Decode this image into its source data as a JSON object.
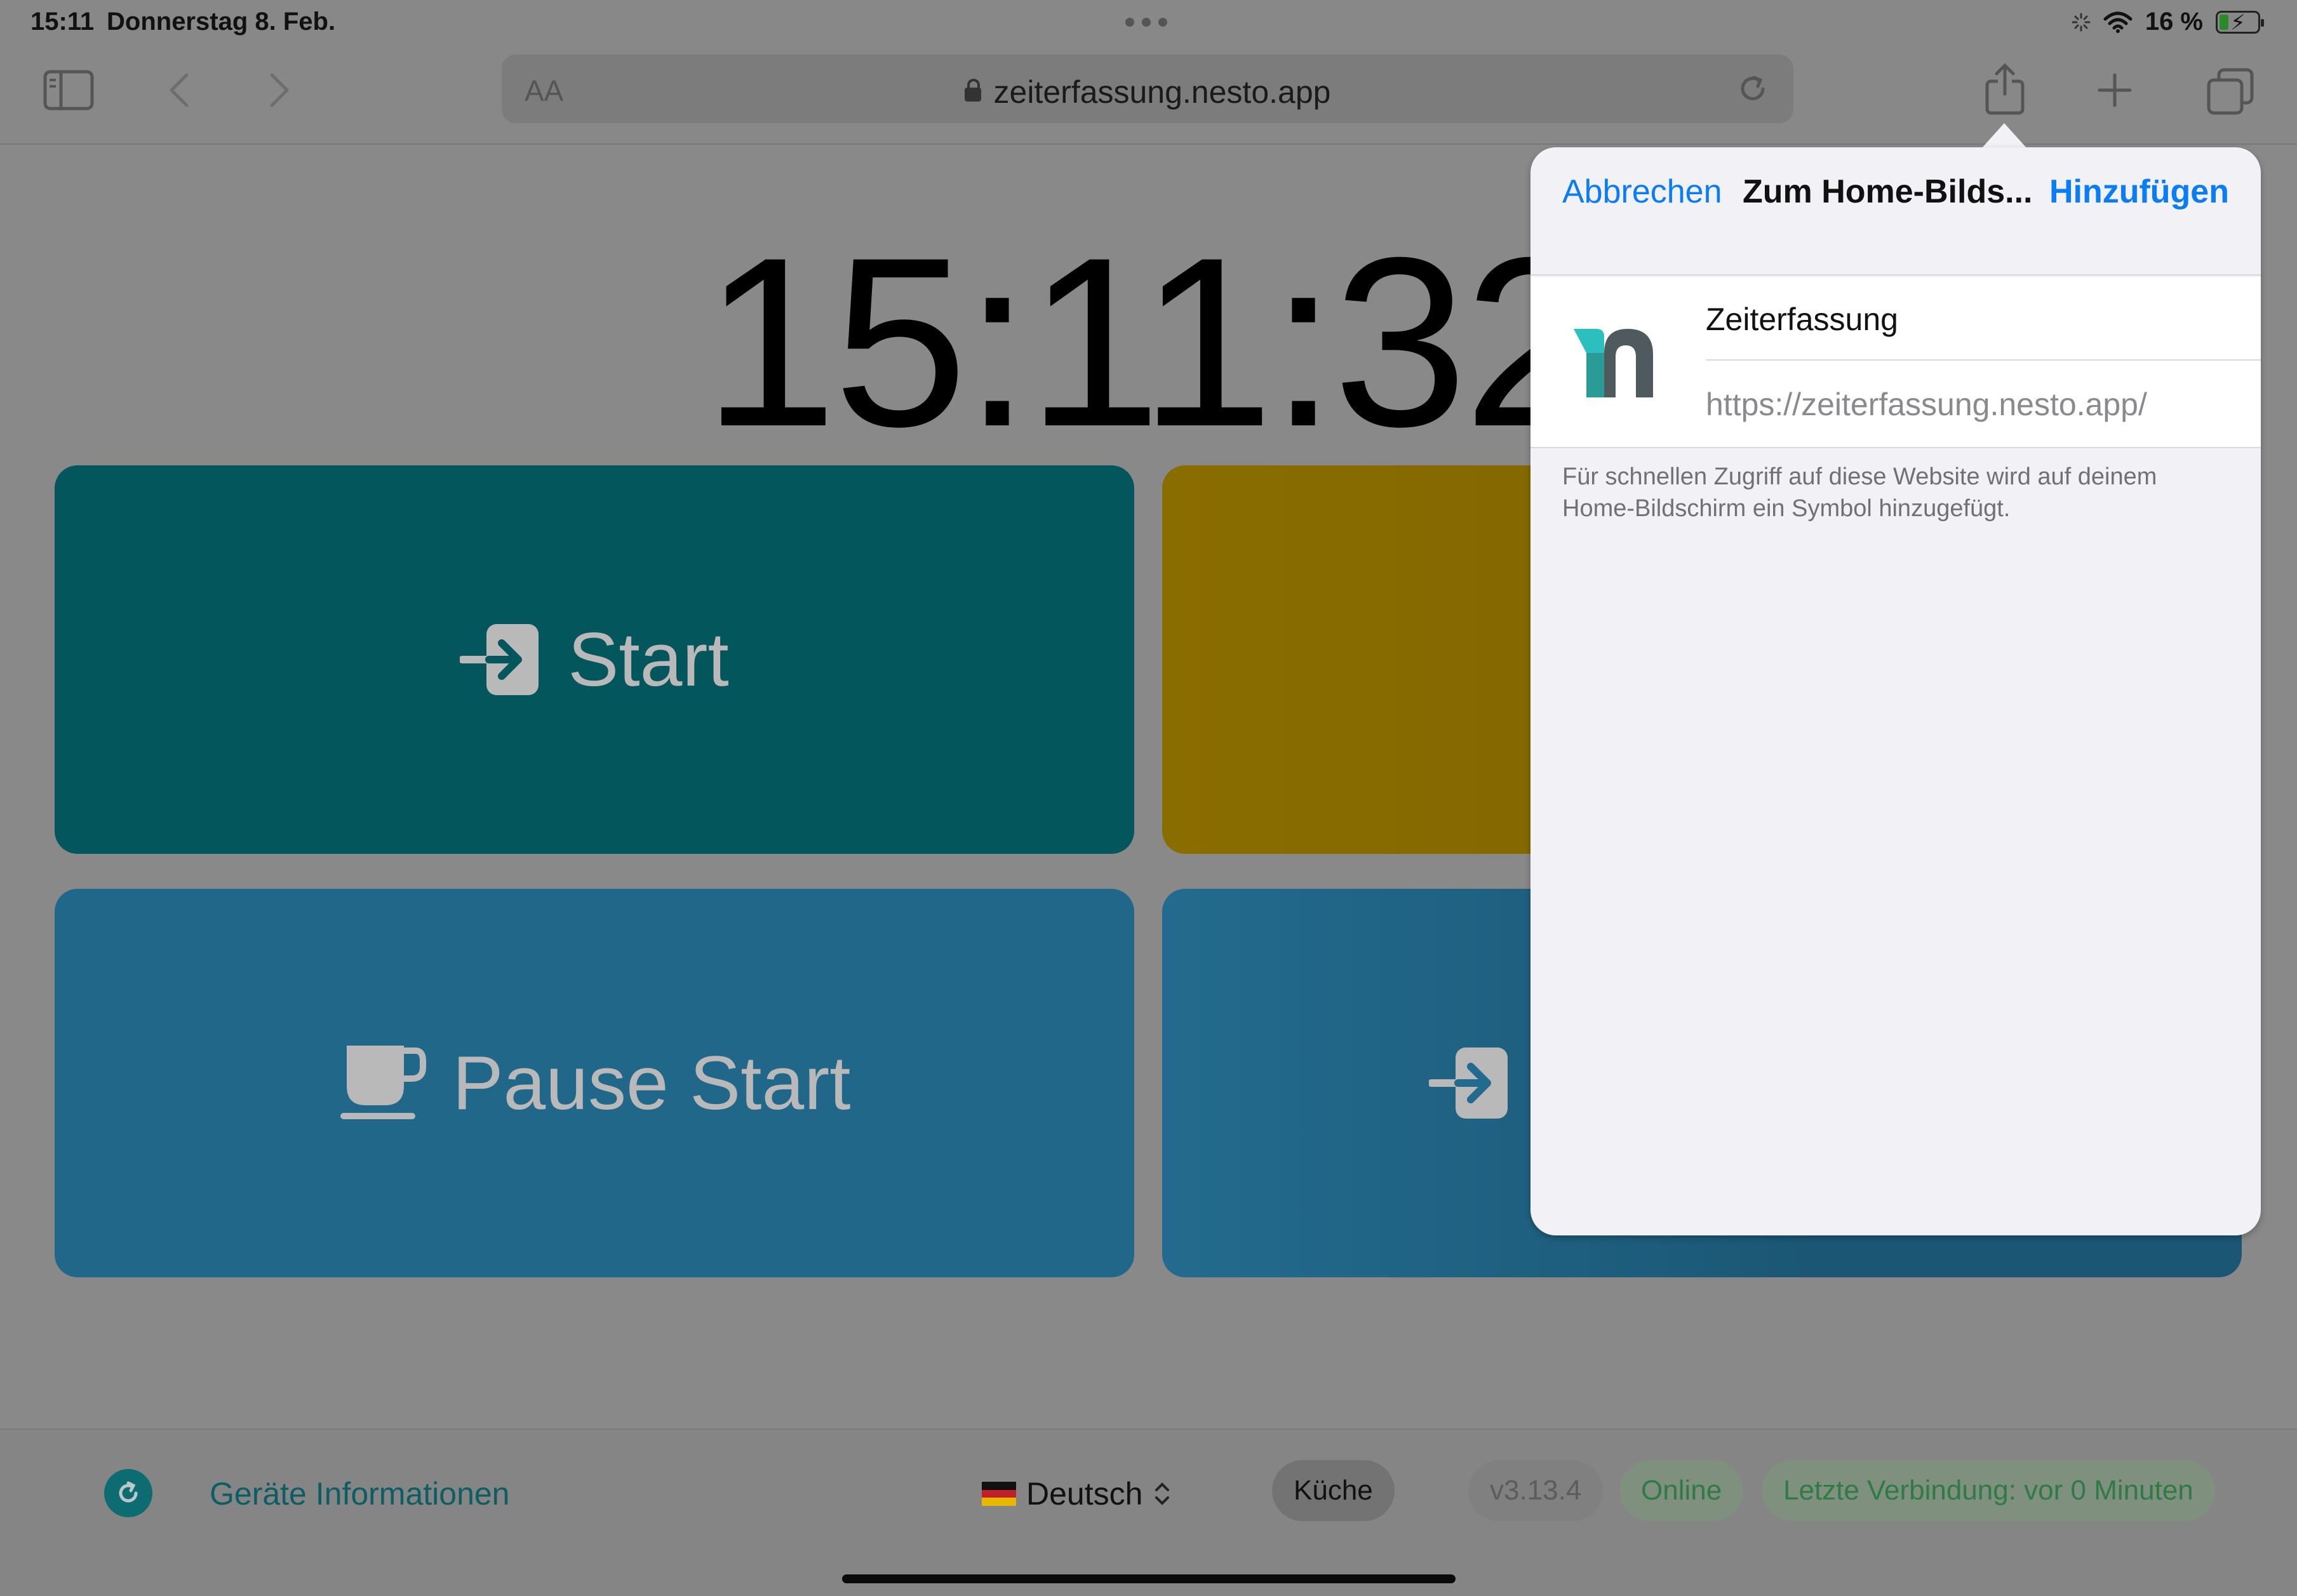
{
  "status_bar": {
    "time": "15:11",
    "date": "Donnerstag 8. Feb.",
    "battery": "16 %"
  },
  "browser": {
    "text_size_label": "AA",
    "url": "zeiterfassung.nesto.app"
  },
  "page": {
    "clock": "15:11:32",
    "tiles": {
      "start_label": "Start",
      "pause_start_label": "Pause Start"
    }
  },
  "footer": {
    "device_info": "Geräte Informationen",
    "language": "Deutsch",
    "location": "Küche",
    "version": "v3.13.4",
    "status": "Online",
    "last_connection": "Letzte Verbindung: vor 0 Minuten"
  },
  "popover": {
    "cancel": "Abbrechen",
    "title": "Zum Home-Bilds...",
    "add": "Hinzufügen",
    "app_name": "Zeiterfassung",
    "app_url": "https://zeiterfassung.nesto.app/",
    "hint": "Für schnellen Zugriff auf diese Website wird auf deinem Home-Bildschirm ein Symbol hinzugefügt."
  },
  "colors": {
    "accent_blue": "#0a7cf6",
    "start_tile": "#03565c",
    "pause_tile": "#216789",
    "online_green": "#2f7a45"
  }
}
